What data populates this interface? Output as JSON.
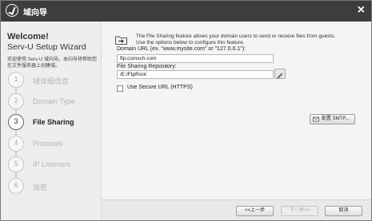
{
  "window": {
    "title": "域向导",
    "close": "×"
  },
  "sidebar": {
    "welcome": "Welcome!",
    "wizard_title": "Serv-U Setup Wizard",
    "intro": "欢迎使用 Serv-U 域向导。本向导将帮助您在文件服务器上创建域。",
    "steps": [
      {
        "num": "1",
        "label": "域详细信息",
        "active": false
      },
      {
        "num": "2",
        "label": "Domain Type",
        "active": false
      },
      {
        "num": "3",
        "label": "File Sharing",
        "active": true
      },
      {
        "num": "4",
        "label": "Protocols",
        "active": false
      },
      {
        "num": "5",
        "label": "IP Listeners",
        "active": false
      },
      {
        "num": "6",
        "label": "加密",
        "active": false
      }
    ]
  },
  "main": {
    "description_line1": "The File Sharing feature allows your domain users to send or receive files from guests.",
    "description_line2": "Use the options below to configure this feature.",
    "domain_url_label": "Domain URL (ex. \"www.mysite.com\" or \"127.0.0.1\"):",
    "domain_url_value": "ftp.comsch.com",
    "repo_label": "File Sharing Repository:",
    "repo_value": "/E:/FtpRoot",
    "secure_url_label": "Use Secure URL (HTTPS)",
    "secure_url_checked": false,
    "smtp_button": "配置 SMTP..."
  },
  "footer": {
    "back": "<<上一步",
    "next": "下一步>>",
    "cancel": "取消"
  },
  "icons": {
    "title_logo": "serv-u-logo-icon",
    "folder": "folder-share-icon",
    "browse": "browse-folder-icon",
    "smtp": "mail-settings-icon"
  }
}
